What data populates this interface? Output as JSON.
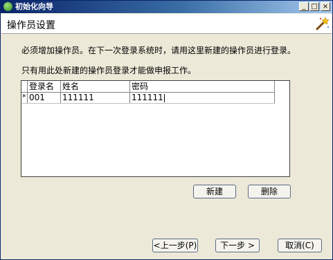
{
  "window": {
    "title": "初始化向导",
    "controls": {
      "minimize": "_",
      "maximize": "□",
      "close": "×"
    }
  },
  "header": {
    "title": "操作员设置"
  },
  "body": {
    "line1": "必须增加操作员。在下一次登录系统时，请用这里新建的操作员进行登录。",
    "line2": "只有用此处新建的操作员登录才能做申报工作。"
  },
  "grid": {
    "columns": [
      "登录名",
      "姓名",
      "密码"
    ],
    "rows": [
      {
        "indicator": "*",
        "login": "001",
        "name": "111111",
        "password": "111111"
      }
    ]
  },
  "actions": {
    "new": "新建",
    "delete": "删除"
  },
  "nav": {
    "back": "<上一步(P)",
    "next": "下一步 >",
    "cancel": "取消(C)"
  }
}
